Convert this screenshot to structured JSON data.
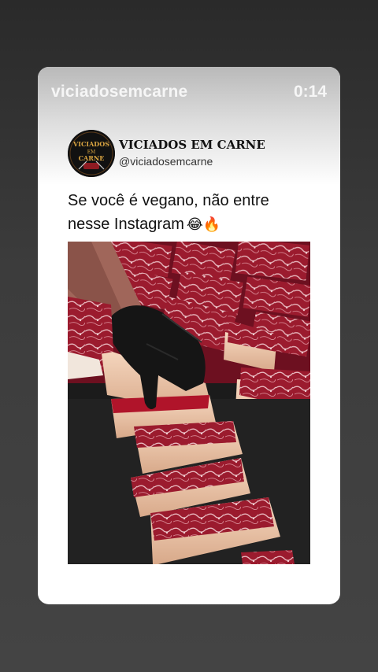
{
  "story": {
    "username": "viciadosemcarne",
    "timestamp": "0:14"
  },
  "post": {
    "avatar_text_top": "VICIADOS",
    "avatar_text_mid": "EM",
    "avatar_text_bottom": "CARNE",
    "display_name": "VICIADOS EM CARNE",
    "handle": "@viciadosemcarne",
    "caption_line1": "Se você é vegano, não entre",
    "caption_line2": "nesse Instagram",
    "caption_emoji": "😂🔥"
  }
}
